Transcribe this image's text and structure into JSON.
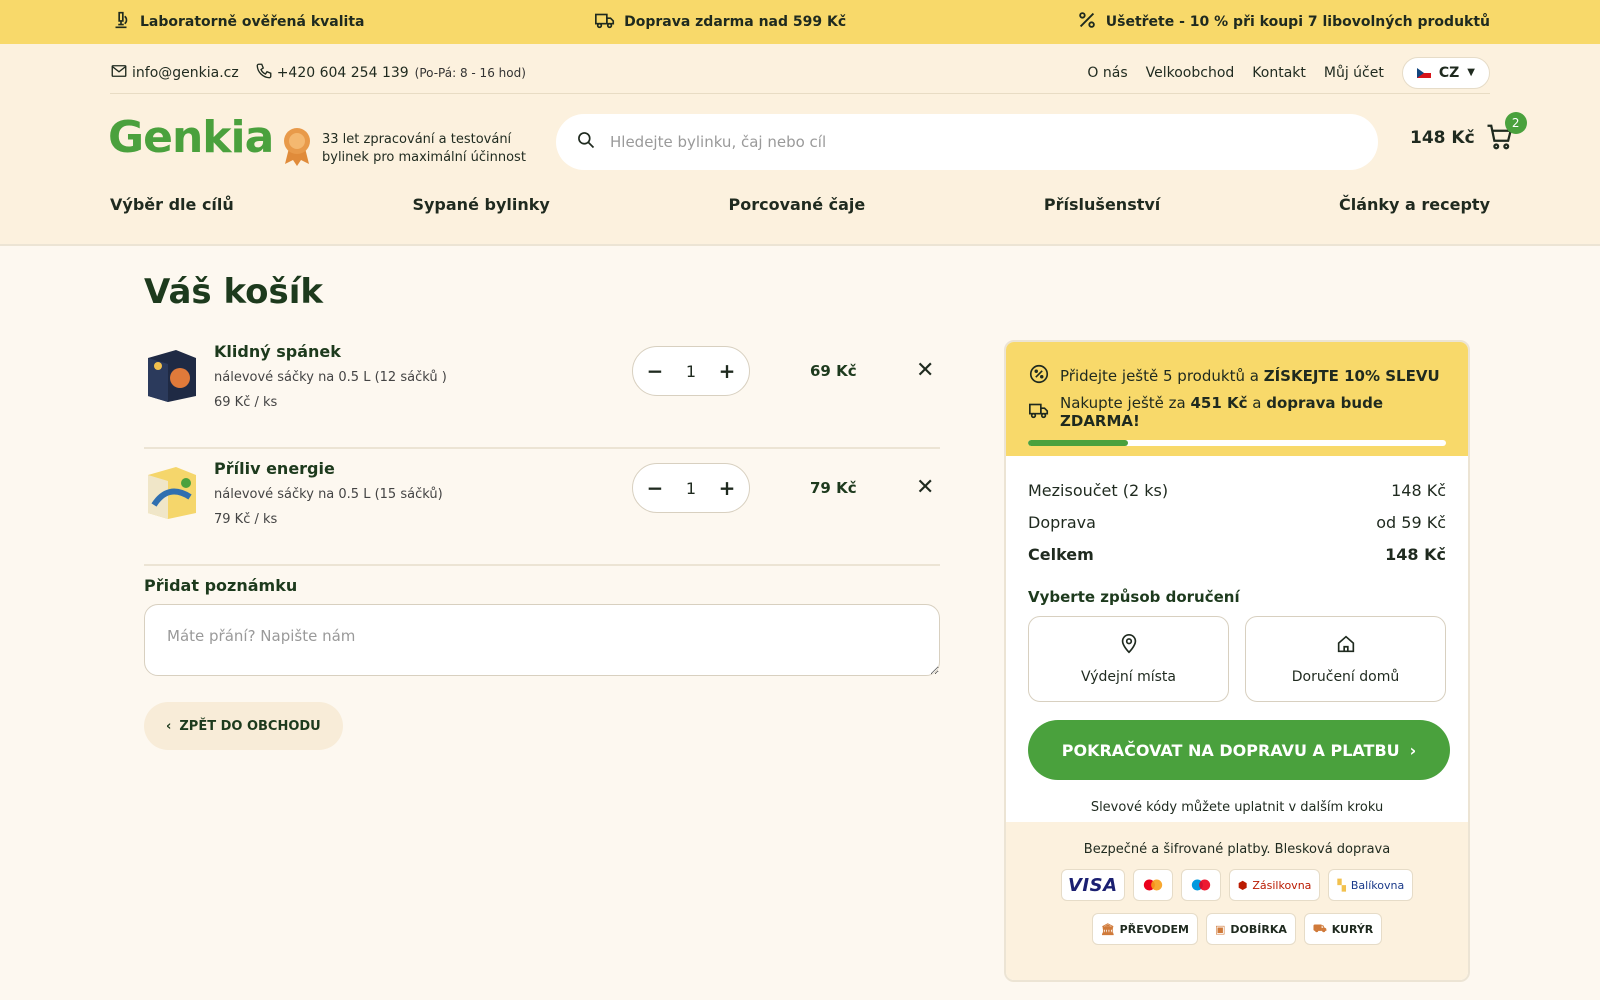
{
  "promo": {
    "quality": "Laboratorně ověřená kvalita",
    "shipping": "Doprava zdarma nad 599 Kč",
    "discount": "Ušetřete - 10 % při koupi 7 libovolných produktů"
  },
  "util": {
    "email": "info@genkia.cz",
    "phone": "+420 604 254 139",
    "hours": "(Po-Pá: 8 - 16 hod)",
    "links": [
      "O nás",
      "Velkoobchod",
      "Kontakt",
      "Můj účet"
    ],
    "lang": "CZ"
  },
  "header": {
    "logo": "Genkia",
    "badge_text": "33 let zpracování a testování bylinek pro maximální účinnost",
    "search_placeholder": "Hledejte bylinku, čaj nebo cíl",
    "cart_total": "148 Kč",
    "cart_count": "2"
  },
  "nav": [
    "Výběr dle cílů",
    "Sypané bylinky",
    "Porcované čaje",
    "Příslušenství",
    "Články a recepty"
  ],
  "cart": {
    "title": "Váš košík",
    "items": [
      {
        "name": "Klidný spánek",
        "desc": "nálevové sáčky na 0.5 L (12 sáčků )",
        "unit": "69 Kč / ks",
        "qty": "1",
        "price": "69 Kč"
      },
      {
        "name": "Příliv energie",
        "desc": "nálevové sáčky na 0.5 L (15 sáčků)",
        "unit": "79 Kč / ks",
        "qty": "1",
        "price": "79 Kč"
      }
    ],
    "note_label": "Přidat poznámku",
    "note_placeholder": "Máte přání? Napište nám",
    "back_label": "ZPĚT DO OBCHODU"
  },
  "summary": {
    "promo1_pre": "Přidejte ještě 5 produktů a ",
    "promo1_bold": "ZÍSKEJTE 10% SLEVU",
    "promo2_pre": "Nakupte ještě za ",
    "promo2_amount": "451 Kč",
    "promo2_mid": " a ",
    "promo2_bold": "doprava bude ZDARMA!",
    "progress_percent": 24,
    "subtotal_label": "Mezisoučet (2 ks)",
    "subtotal_value": "148 Kč",
    "shipping_label": "Doprava",
    "shipping_value": "od 59 Kč",
    "total_label": "Celkem",
    "total_value": "148 Kč",
    "delivery_title": "Vyberte způsob doručení",
    "delivery_options": [
      "Výdejní místa",
      "Doručení domů"
    ],
    "cta": "POKRAČOVAT NA DOPRAVU A PLATBU",
    "discount_note": "Slevové kódy můžete uplatnit v dalším kroku",
    "payment_title": "Bezpečné a šifrované platby. Blesková doprava",
    "payments_row1": [
      "VISA",
      "Zásilkovna",
      "Balíkovna"
    ],
    "payments_row2": [
      "PŘEVODEM",
      "DOBÍRKA",
      "KURÝR"
    ]
  },
  "colors": {
    "accent": "#4aa13d",
    "promo_bg": "#f8d96a",
    "header_bg": "#fcf1de"
  },
  "icons": [
    "microscope-icon",
    "truck-icon",
    "percent-icon",
    "mail-icon",
    "phone-icon",
    "search-icon",
    "cart-icon",
    "award-icon",
    "location-pin-icon",
    "home-icon",
    "chevron-left-icon",
    "chevron-right-icon",
    "close-icon"
  ]
}
